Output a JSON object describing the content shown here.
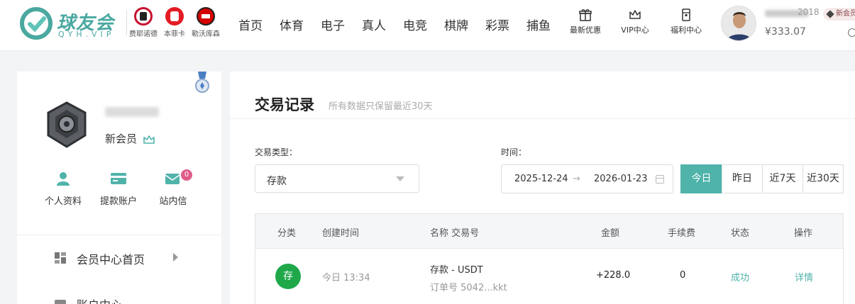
{
  "brand": {
    "name": "球友会",
    "sub": "QYH.VIP",
    "accent": "#4aa8a0"
  },
  "partners": [
    {
      "label": "费耶诺德",
      "color": "#c8102e"
    },
    {
      "label": "本菲卡",
      "color": "#e31b23"
    },
    {
      "label": "勒沃库森",
      "color": "#d40000"
    }
  ],
  "nav": [
    "首页",
    "体育",
    "电子",
    "真人",
    "电竞",
    "棋牌",
    "彩票",
    "捕鱼"
  ],
  "promos": [
    {
      "label": "最新优惠",
      "icon": "gift-icon"
    },
    {
      "label": "VIP中心",
      "icon": "crown-icon"
    },
    {
      "label": "福利中心",
      "icon": "welfare-icon"
    }
  ],
  "account": {
    "username_tail": "2018",
    "balance": "¥333.07",
    "vip_tag": "新会员"
  },
  "profile": {
    "level": "新会员",
    "quick_links": [
      {
        "label": "个人资料",
        "icon": "user-icon"
      },
      {
        "label": "提款账户",
        "icon": "card-icon"
      },
      {
        "label": "站内信",
        "icon": "mail-icon",
        "badge": "0"
      }
    ],
    "menu": [
      {
        "label": "会员中心首页",
        "icon": "dashboard-icon"
      },
      {
        "label": "账户中心",
        "icon": "wallet-icon"
      }
    ]
  },
  "transactions": {
    "title": "交易记录",
    "subtitle": "所有数据只保留最近30天",
    "type_label": "交易类型：",
    "type_value": "存款",
    "time_label": "时间：",
    "date_from": "2025-12-24",
    "date_arrow": "→",
    "date_to": "2026-01-23",
    "ranges": [
      "今日",
      "昨日",
      "近7天",
      "近30天"
    ],
    "active_range": "今日",
    "columns": [
      "分类",
      "创建时间",
      "名称 交易号",
      "金额",
      "手续费",
      "状态",
      "操作"
    ],
    "rows": [
      {
        "category": "存",
        "created": "今日 13:34",
        "name": "存款 - USDT",
        "order": "订单号 5042...kkt",
        "amount": "+228.0",
        "fee": "0",
        "status": "成功",
        "action": "详情"
      }
    ]
  },
  "colors": {
    "teal": "#4fb3aa",
    "success_green": "#1ea84a",
    "badge_pink": "#e05b8a"
  }
}
